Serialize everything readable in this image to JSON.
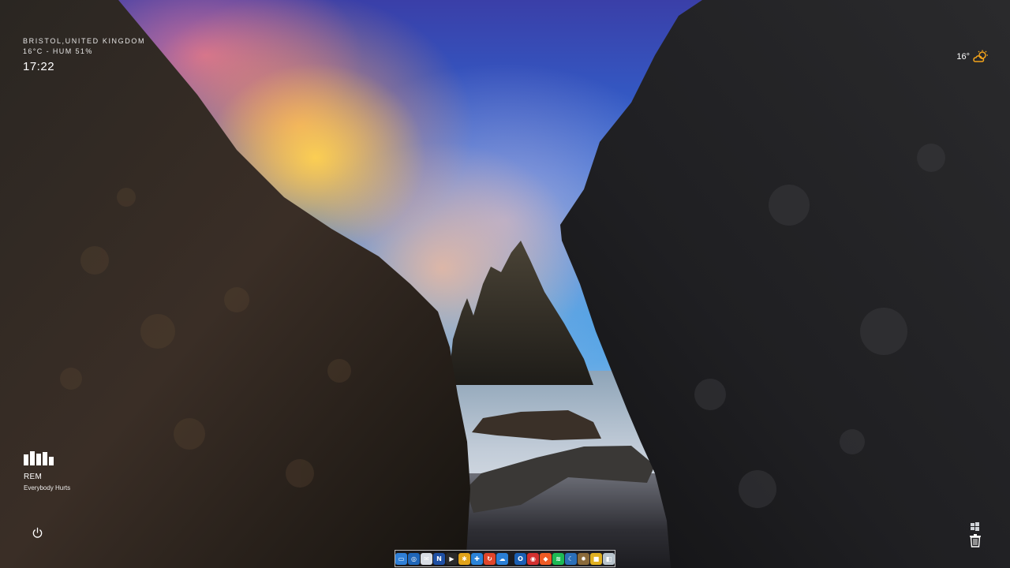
{
  "weather_widget": {
    "location": "BRISTOL,UNITED KINGDOM",
    "conditions": "16°C - HUM 51%",
    "time": "17:22"
  },
  "weather_mini": {
    "temp": "16°",
    "icon": "sun-cloud-icon",
    "icon_color": "#f2a31b"
  },
  "now_playing": {
    "artist": "REM",
    "track": "Everybody Hurts",
    "bar_levels": [
      0.75,
      1.0,
      0.85,
      0.95,
      0.6
    ]
  },
  "dock": {
    "items": [
      {
        "name": "computer-icon",
        "glyph": "▭",
        "color": "#2f7fd6"
      },
      {
        "name": "finder-search-icon",
        "glyph": "◎",
        "color": "#1f66b8"
      },
      {
        "name": "mail-icon",
        "glyph": "✉",
        "color": "#d8dde4"
      },
      {
        "name": "onenote-icon",
        "glyph": "N",
        "color": "#1e4fa3"
      },
      {
        "name": "media-player-icon",
        "glyph": "▶",
        "color": "#2a2a2a"
      },
      {
        "name": "bee-app-icon",
        "glyph": "✱",
        "color": "#e0a21a"
      },
      {
        "name": "tools-icon",
        "glyph": "✚",
        "color": "#2a83d8"
      },
      {
        "name": "sync-icon",
        "glyph": "↻",
        "color": "#e0452a"
      },
      {
        "name": "cloud-icon",
        "glyph": "☁",
        "color": "#2a7fd6"
      },
      {
        "name": "outlook-icon",
        "glyph": "O",
        "color": "#1a5fb4"
      },
      {
        "name": "creative-cloud-icon",
        "glyph": "◉",
        "color": "#d3302f"
      },
      {
        "name": "brave-icon",
        "glyph": "◆",
        "color": "#ef5b25"
      },
      {
        "name": "spotify-icon",
        "glyph": "≋",
        "color": "#1db954"
      },
      {
        "name": "moon-icon",
        "glyph": "☾",
        "color": "#2b6fb8"
      },
      {
        "name": "settings-icon",
        "glyph": "✹",
        "color": "#8a6a3a"
      },
      {
        "name": "lock-icon",
        "glyph": "■",
        "color": "#e0b020"
      },
      {
        "name": "box-icon",
        "glyph": "◧",
        "color": "#b8c4cc"
      }
    ]
  }
}
